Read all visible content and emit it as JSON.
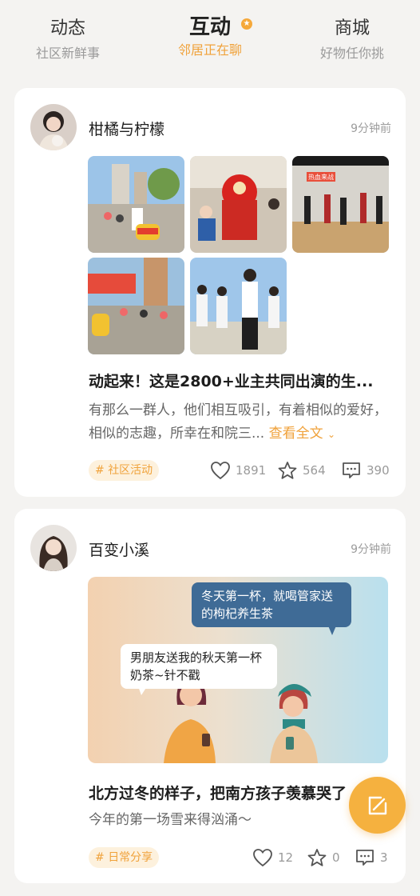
{
  "tabs": [
    {
      "label": "动态",
      "sub": "社区新鲜事"
    },
    {
      "label": "互动",
      "sub": "邻居正在聊"
    },
    {
      "label": "商城",
      "sub": "好物任你挑"
    }
  ],
  "active_tab_badge": "",
  "posts": [
    {
      "user": "柑橘与柠檬",
      "time": "9分钟前",
      "title": "动起来！这是2800+业主共同出演的生...",
      "body": "有那么一群人，他们相互吸引，有着相似的爱好，相似的志趣，所幸在和院三...",
      "more": "查看全文",
      "tag": "社区活动",
      "likes": "1891",
      "stars": "564",
      "comments": "390",
      "photo_banner": "热血来战"
    },
    {
      "user": "百变小溪",
      "time": "9分钟前",
      "title": "北方过冬的样子，把南方孩子羡慕哭了",
      "body": "今年的第一场雪来得汹涌～",
      "tag": "日常分享",
      "likes": "12",
      "stars": "0",
      "comments": "3",
      "bubble_right": "冬天第一杯，就喝管家送的枸杞养生茶",
      "bubble_left": "男朋友送我的秋天第一杯奶茶~针不戳"
    }
  ],
  "colors": {
    "accent": "#f0a23b",
    "background": "#f4f3f1",
    "tag_bg": "#fdf1dd"
  },
  "icons": [
    "heart-icon",
    "star-icon",
    "comment-icon",
    "edit-icon"
  ]
}
